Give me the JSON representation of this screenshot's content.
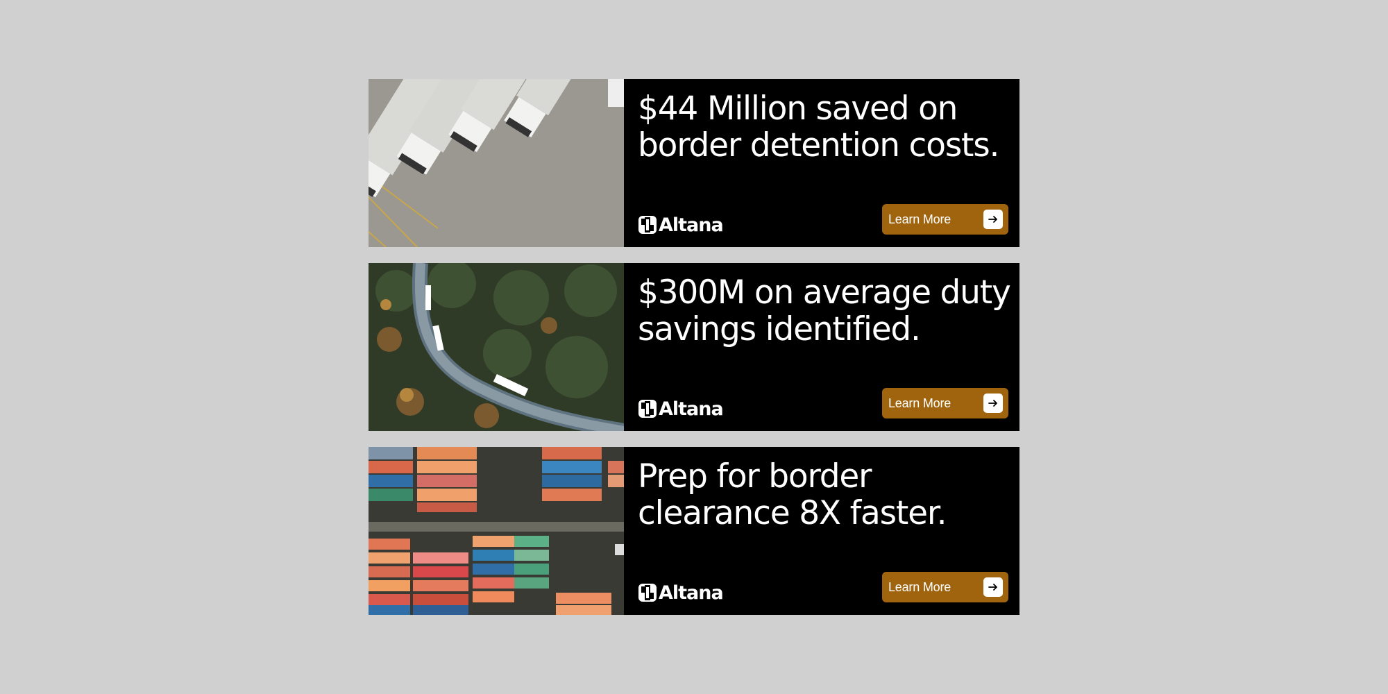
{
  "brand": {
    "name": "Altana",
    "accent_color": "#a0640f",
    "panel_color": "#000000",
    "background_color": "#d0d0d0"
  },
  "banners": [
    {
      "headline_line1": "$44 Million saved on",
      "headline_line2": "border detention costs.",
      "cta_label": "Learn More",
      "cta_icon": "arrow-right-icon",
      "photo": "aerial-trucks-parked-photo"
    },
    {
      "headline_line1": "$300M on average duty",
      "headline_line2": "savings identified.",
      "cta_label": "Learn More",
      "cta_icon": "arrow-right-icon",
      "photo": "aerial-trucks-forest-road-photo"
    },
    {
      "headline_line1": "Prep for border",
      "headline_line2": "clearance 8X faster.",
      "cta_label": "Learn More",
      "cta_icon": "arrow-right-icon",
      "photo": "aerial-shipping-containers-photo"
    }
  ]
}
